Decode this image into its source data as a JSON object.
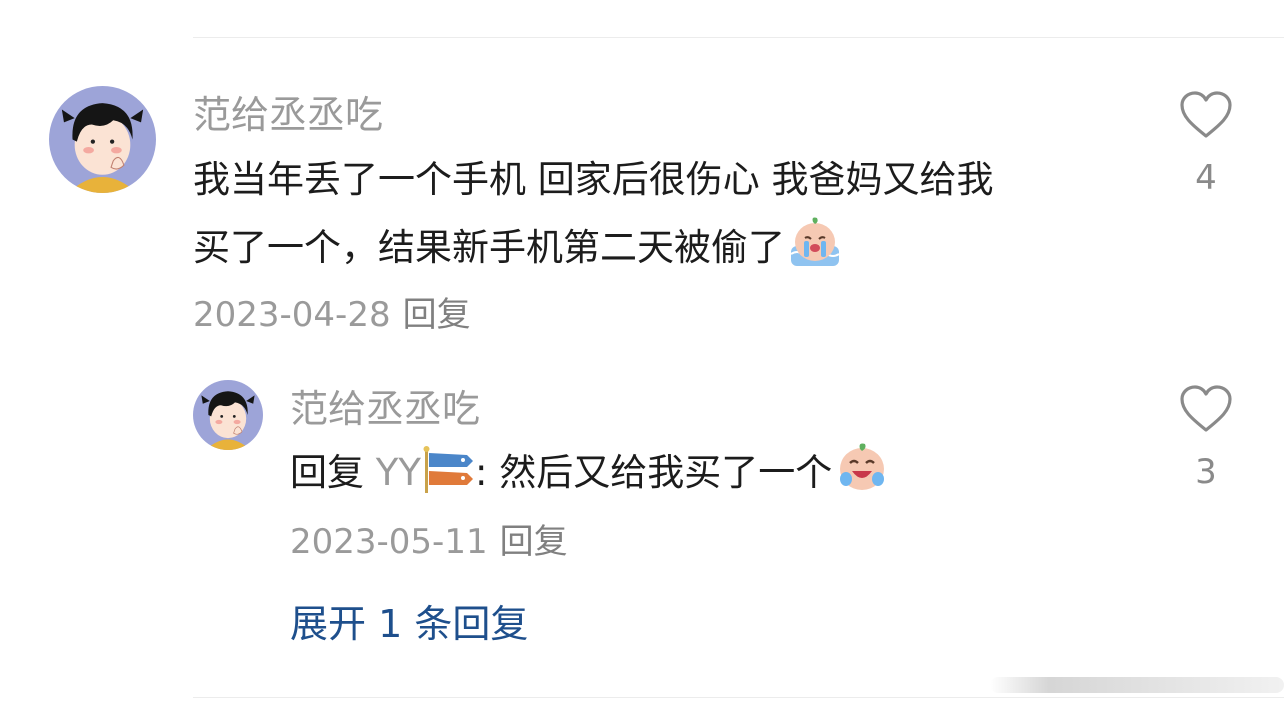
{
  "comment": {
    "username": "范给丞丞吃",
    "text_line1": "我当年丢了一个手机 回家后很伤心 我爸妈又给我",
    "text_line2": "买了一个，结果新手机第二天被偷了",
    "emoji": "crying-face-emoji",
    "date": "2023-04-28",
    "reply_label": "回复",
    "like_count": "4",
    "avatar": "cartoon-girl-avatar"
  },
  "reply": {
    "username": "范给丞丞吃",
    "prefix": "回复",
    "mention": "YY",
    "mention_badge": "koinobori-emoji",
    "separator": ":",
    "text": "然后又给我买了一个",
    "emoji": "laughing-crying-emoji",
    "date": "2023-05-11",
    "reply_label": "回复",
    "like_count": "3",
    "avatar": "cartoon-girl-avatar"
  },
  "expand": {
    "label": "展开 1 条回复"
  },
  "colors": {
    "username": "#9a9a9a",
    "text": "#1c1c1c",
    "meta": "#9a9a9a",
    "link": "#1e4f8c",
    "avatar_bg": "#9da4d8"
  }
}
